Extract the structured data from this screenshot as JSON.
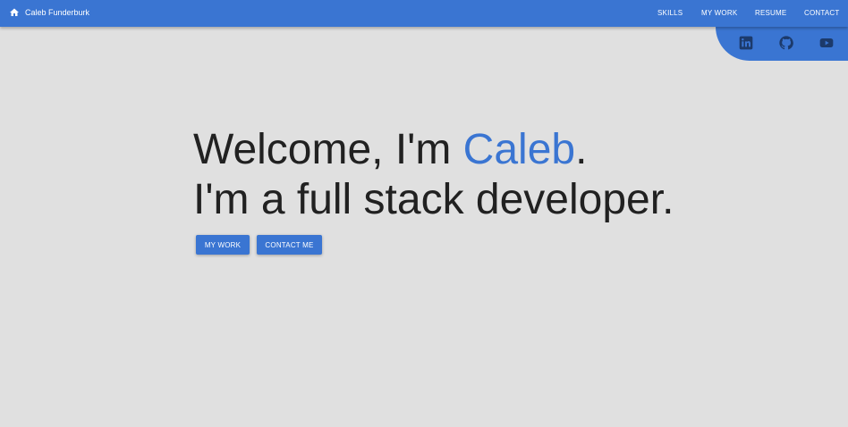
{
  "header": {
    "brand": "Caleb Funderburk",
    "home_icon": "home-icon",
    "nav": [
      "SKILLS",
      "MY WORK",
      "RESUME",
      "CONTACT"
    ]
  },
  "social": {
    "icons": [
      "linkedin-icon",
      "github-icon",
      "youtube-icon"
    ]
  },
  "hero": {
    "line1_prefix": "Welcome, I'm ",
    "line1_name": "Caleb",
    "line1_suffix": ".",
    "line2": "I'm a full stack developer."
  },
  "buttons": {
    "my_work": "MY WORK",
    "contact_me": "CONTACT ME"
  },
  "colors": {
    "primary": "#3a75d2",
    "background": "#e0e0e0",
    "text": "#212121",
    "icon_dark": "#1c3a6b"
  }
}
